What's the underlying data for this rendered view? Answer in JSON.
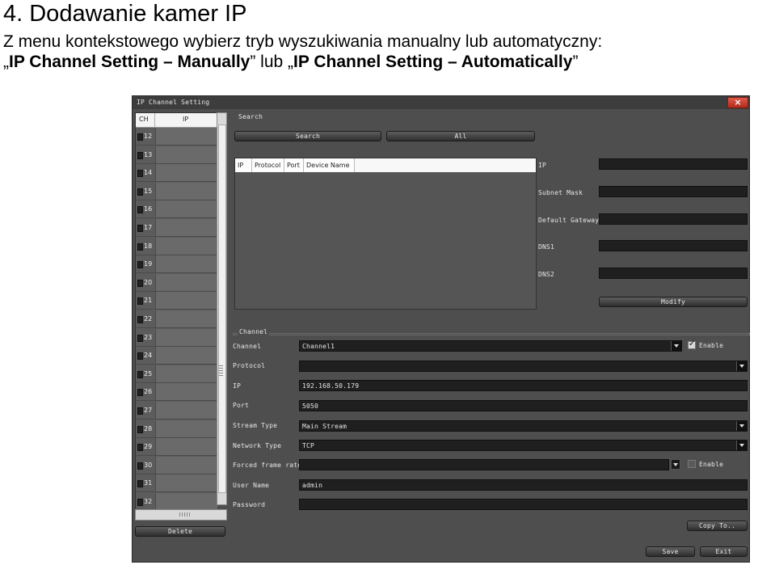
{
  "doc": {
    "title": "4. Dodawanie kamer IP",
    "intro": "Z menu kontekstowego wybierz tryb wyszukiwania manualny lub automatyczny:",
    "opt_open": "„",
    "opt_manual": "IP Channel Setting – Manually",
    "opt_mid": "” lub „",
    "opt_auto": "IP Channel Setting – Automatically",
    "opt_close": "”"
  },
  "window": {
    "title": "IP Channel Setting",
    "close_label": "×"
  },
  "channel_list": {
    "headers": {
      "ch": "CH",
      "ip": "IP"
    },
    "rows": [
      "12",
      "13",
      "14",
      "15",
      "16",
      "17",
      "18",
      "19",
      "20",
      "21",
      "22",
      "23",
      "24",
      "25",
      "26",
      "27",
      "28",
      "29",
      "30",
      "31",
      "32"
    ],
    "delete_label": "Delete"
  },
  "search": {
    "group_label": "Search",
    "search_button": "Search",
    "all_button": "All",
    "columns": [
      "IP",
      "Protocol",
      "Port",
      "Device Name"
    ]
  },
  "network": {
    "ip_label": "IP",
    "subnet_label": "Subnet Mask",
    "gateway_label": "Default Gateway",
    "dns1_label": "DNS1",
    "dns2_label": "DNS2",
    "ip_value": "",
    "subnet_value": "",
    "gateway_value": "",
    "dns1_value": "",
    "dns2_value": "",
    "modify_button": "Modify"
  },
  "channel": {
    "group_label": "Channel",
    "channel_label": "Channel",
    "channel_value": "Channel1",
    "enable_label": "Enable",
    "enable_checked": true,
    "protocol_label": "Protocol",
    "protocol_value": "",
    "ip_label": "IP",
    "ip_value": "192.168.50.179",
    "port_label": "Port",
    "port_value": "5050",
    "stream_label": "Stream Type",
    "stream_value": "Main Stream",
    "network_label": "Network Type",
    "network_value": "TCP",
    "frame_label": "Forced frame rate",
    "frame_value": "",
    "frame_enable_label": "Enable",
    "frame_enable_checked": false,
    "user_label": "User Name",
    "user_value": "admin",
    "password_label": "Password",
    "password_value": "",
    "copy_button": "Copy To..",
    "save_button": "Save",
    "exit_button": "Exit"
  },
  "colors": {
    "window_bg": "#4e4e4e",
    "field_bg": "#1f1f1f",
    "close_red": "#c83a2a"
  }
}
